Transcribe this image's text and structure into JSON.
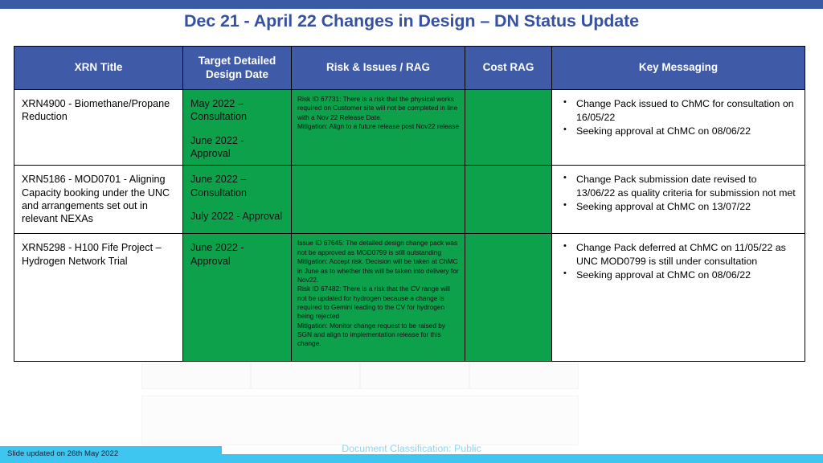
{
  "slide": {
    "title": "Dec 21 - April 22 Changes in Design – DN Status Update",
    "footer_left": "Slide updated on 26th May 2022",
    "document_classification": "Document Classification: Public",
    "accent_blue": "#3f5aa6",
    "accent_cyan": "#3fc6f0",
    "rag_green": "#0da14c"
  },
  "table": {
    "headers": [
      "XRN Title",
      "Target Detailed Design Date",
      "Risk & Issues / RAG",
      "Cost RAG",
      "Key Messaging"
    ],
    "rows": [
      {
        "xrn_title": "XRN4900 - Biomethane/Propane Reduction",
        "target_date_1": "May 2022 – Consultation",
        "target_date_2": "June 2022 - Approval",
        "risk_rag": "green",
        "risk_text": [
          "Risk ID 67731: There is a risk that the physical works required on Customer site will not be completed in line with a Nov 22 Release Date.",
          "Mitigation: Align to a future release post Nov22 release"
        ],
        "cost_rag": "green",
        "key_messaging": [
          "Change Pack issued to ChMC for consultation on 16/05/22",
          "Seeking approval at ChMC on 08/06/22"
        ]
      },
      {
        "xrn_title": "XRN5186 - MOD0701 - Aligning Capacity booking under the UNC and arrangements set out in relevant NEXAs",
        "target_date_1": "June  2022 –  Consultation",
        "target_date_2": "July 2022 -  Approval",
        "risk_rag": "green",
        "risk_text": [],
        "cost_rag": "green",
        "key_messaging": [
          "Change Pack submission date revised to 13/06/22 as quality criteria for submission not met",
          "Seeking approval at ChMC on 13/07/22"
        ]
      },
      {
        "xrn_title": "XRN5298 - H100 Fife Project – Hydrogen Network Trial",
        "target_date_1": "June  2022 - Approval",
        "target_date_2": "",
        "risk_rag": "green",
        "risk_text": [
          "Issue ID 67645: The detailed design change pack was not be approved as MOD0799 is still outstanding",
          "Mitigation: Accept risk. Decision will be taken at ChMC in June as to  whether this will be taken into delivery for Nov22.",
          "Risk ID 67482: There is a risk that the CV range will not be updated for hydrogen because a change is required to Gemini leading to the CV for hydrogen being rejected",
          "Mitigation: Monitor change request to be raised by SGN and align to implementation release for this change."
        ],
        "cost_rag": "green",
        "key_messaging": [
          "Change Pack deferred at ChMC on 11/05/22 as UNC MOD0799 is still under consultation",
          "Seeking approval at ChMC on 08/06/22"
        ]
      }
    ]
  }
}
